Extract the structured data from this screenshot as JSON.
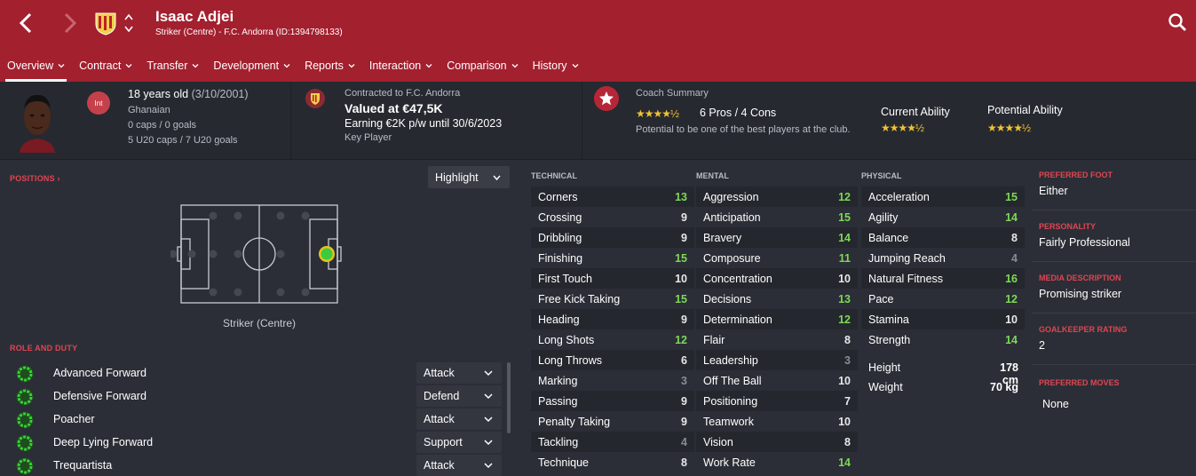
{
  "header": {
    "name": "Isaac Adjei",
    "subtitle": "Striker (Centre) - F.C. Andorra (ID:1394798133)",
    "tabs": [
      "Overview",
      "Contract",
      "Transfer",
      "Development",
      "Reports",
      "Interaction",
      "Comparison",
      "History"
    ]
  },
  "summary": {
    "int_badge": "Int",
    "age": "18 years old",
    "dob": "(3/10/2001)",
    "nationality": "Ghanaian",
    "caps": "0 caps / 0 goals",
    "u20_caps": "5 U20 caps / 7 U20 goals",
    "contract_title": "Contracted to F.C. Andorra",
    "valued": "Valued at €47,5K",
    "earning": "Earning €2K p/w until 30/6/2023",
    "squad_status": "Key Player",
    "coach_title": "Coach Summary",
    "coach_stars": "★★★★½",
    "pros_cons": "6 Pros / 4 Cons",
    "potential_text": "Potential to be one of the best players at the club.",
    "ca_label": "Current Ability",
    "ca_stars": "★★★★½",
    "pa_label": "Potential Ability",
    "pa_stars": "★★★★½"
  },
  "positions": {
    "label": "POSITIONS",
    "highlight": "Highlight",
    "position_label": "Striker (Centre)"
  },
  "roles": {
    "label": "ROLE AND DUTY",
    "items": [
      {
        "name": "Advanced Forward",
        "duty": "Attack"
      },
      {
        "name": "Defensive Forward",
        "duty": "Defend"
      },
      {
        "name": "Poacher",
        "duty": "Attack"
      },
      {
        "name": "Deep Lying Forward",
        "duty": "Support"
      },
      {
        "name": "Trequartista",
        "duty": "Attack"
      }
    ]
  },
  "attributes": {
    "technical_label": "TECHNICAL",
    "mental_label": "MENTAL",
    "physical_label": "PHYSICAL",
    "technical": [
      {
        "name": "Corners",
        "value": "13"
      },
      {
        "name": "Crossing",
        "value": "9"
      },
      {
        "name": "Dribbling",
        "value": "9"
      },
      {
        "name": "Finishing",
        "value": "15"
      },
      {
        "name": "First Touch",
        "value": "10"
      },
      {
        "name": "Free Kick Taking",
        "value": "15"
      },
      {
        "name": "Heading",
        "value": "9"
      },
      {
        "name": "Long Shots",
        "value": "12"
      },
      {
        "name": "Long Throws",
        "value": "6"
      },
      {
        "name": "Marking",
        "value": "3"
      },
      {
        "name": "Passing",
        "value": "9"
      },
      {
        "name": "Penalty Taking",
        "value": "9"
      },
      {
        "name": "Tackling",
        "value": "4"
      },
      {
        "name": "Technique",
        "value": "8"
      }
    ],
    "mental": [
      {
        "name": "Aggression",
        "value": "12"
      },
      {
        "name": "Anticipation",
        "value": "15"
      },
      {
        "name": "Bravery",
        "value": "14"
      },
      {
        "name": "Composure",
        "value": "11"
      },
      {
        "name": "Concentration",
        "value": "10"
      },
      {
        "name": "Decisions",
        "value": "13"
      },
      {
        "name": "Determination",
        "value": "12"
      },
      {
        "name": "Flair",
        "value": "8"
      },
      {
        "name": "Leadership",
        "value": "3"
      },
      {
        "name": "Off The Ball",
        "value": "10"
      },
      {
        "name": "Positioning",
        "value": "7"
      },
      {
        "name": "Teamwork",
        "value": "10"
      },
      {
        "name": "Vision",
        "value": "8"
      },
      {
        "name": "Work Rate",
        "value": "14"
      }
    ],
    "physical": [
      {
        "name": "Acceleration",
        "value": "15"
      },
      {
        "name": "Agility",
        "value": "14"
      },
      {
        "name": "Balance",
        "value": "8"
      },
      {
        "name": "Jumping Reach",
        "value": "4"
      },
      {
        "name": "Natural Fitness",
        "value": "16"
      },
      {
        "name": "Pace",
        "value": "12"
      },
      {
        "name": "Stamina",
        "value": "10"
      },
      {
        "name": "Strength",
        "value": "14"
      }
    ],
    "height_label": "Height",
    "height": "178 cm",
    "weight_label": "Weight",
    "weight": "70 kg"
  },
  "right_panel": {
    "preferred_foot_label": "PREFERRED FOOT",
    "preferred_foot": "Either",
    "personality_label": "PERSONALITY",
    "personality": "Fairly Professional",
    "media_label": "MEDIA DESCRIPTION",
    "media": "Promising striker",
    "gk_label": "GOALKEEPER RATING",
    "gk": "2",
    "moves_label": "PREFERRED MOVES",
    "moves": "None"
  }
}
